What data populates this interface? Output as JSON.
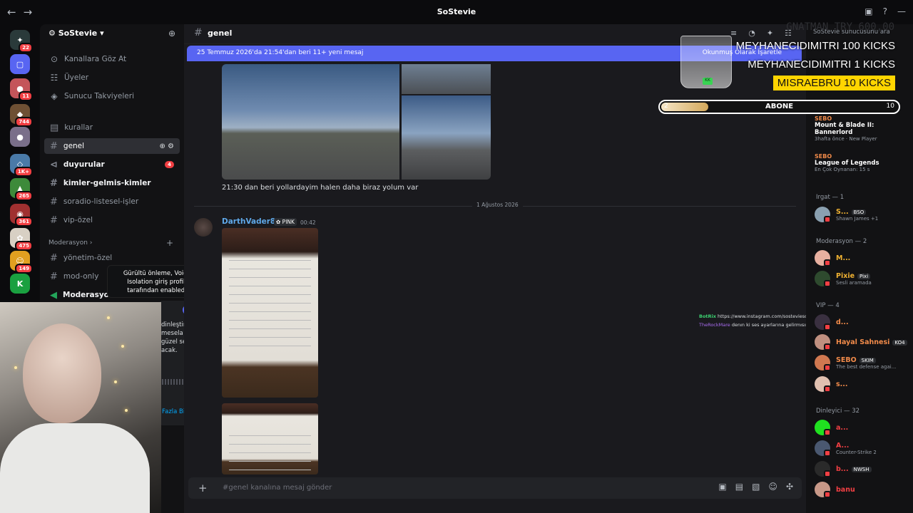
{
  "window": {
    "title": "SoStevie"
  },
  "rail": {
    "badges": [
      "22",
      "11",
      "744",
      "1K+",
      "265",
      "361",
      "475",
      "149"
    ]
  },
  "sidebar": {
    "server_name": "SoStevie",
    "top_items": [
      {
        "label": "Kanallara Göz At",
        "icon": "compass-icon"
      },
      {
        "label": "Üyeler",
        "icon": "members-icon"
      },
      {
        "label": "Sunucu Takviyeleri",
        "icon": "boost-icon"
      }
    ],
    "channels": [
      {
        "name": "kurallar",
        "icon": "rules-icon"
      },
      {
        "name": "genel",
        "active": true
      },
      {
        "name": "duyurular",
        "mention": "4"
      },
      {
        "name": "kimler-gelmis-kimler"
      },
      {
        "name": "soradio-listesel-işler"
      },
      {
        "name": "vip-özel"
      }
    ],
    "category": "Moderasyon",
    "mod_channels": [
      {
        "name": "yönetim-özel"
      },
      {
        "name": "mod-only"
      },
      {
        "name": "Moderasyon"
      }
    ]
  },
  "tooltip": {
    "text": "Gürültü önleme, Voice Isolation giriş profili tarafından enabled."
  },
  "popover": {
    "lines": [
      "dinleştir!",
      "mesela ellerini",
      "güzel sesin",
      "acak."
    ],
    "link": "Fazla Bilgi Edin"
  },
  "main": {
    "channel": "genel",
    "new_messages": "25 Temmuz 2026'da 21:54'dan beri 11+ yeni mesaj",
    "mark_read": "Okunmuş Olarak İşaretle",
    "message_text": "21:30 dan beri yollardayim halen daha biraz yolum var",
    "date_divider": "1 Ağustos 2026",
    "message2": {
      "author": "DarthVader88",
      "role": "PINK",
      "time": "00:42"
    },
    "composer_placeholder": "#genel kanalına mesaj gönder"
  },
  "chat_overlay": [
    {
      "user": "BotRix",
      "text": "https://www.instagram.com/sostevieso/"
    },
    {
      "user": "TheRockMare",
      "text": "denın ki ses ayarlarına gelirmısın"
    }
  ],
  "overlay": {
    "amount": "GNATMAN TRY 600,00",
    "lines": [
      "MEYHANECIDIMITRI  100 KICKS",
      "MEYHANECIDIMITRI  1 KICKS"
    ],
    "highlight": "MISRAEBRU  10 KICKS",
    "sub_goal": {
      "label": "ABONE",
      "current": "2",
      "target": "10",
      "progress": 0.2
    }
  },
  "members": {
    "search_placeholder": "SoStevie sunucusunu ara",
    "activities": [
      {
        "by": "SEBO",
        "title": "Mount & Blade II: Bannerlord",
        "sub": "3hafta önce · New Player"
      },
      {
        "by": "SEBO",
        "title": "League of Legends",
        "sub": "En Çok Oynanan: 15 s"
      }
    ],
    "groups": [
      {
        "label": "Irgat — 1",
        "items": [
          {
            "name": "S...",
            "tag": "BSO",
            "status": "Shawn James +1",
            "color": "#f0b232"
          }
        ]
      },
      {
        "label": "Moderasyon — 2",
        "items": [
          {
            "name": "M...",
            "color": "#f0b232"
          },
          {
            "name": "Pixie",
            "tag": "Pixi",
            "status": "Sesli aramada",
            "color": "#f0b232"
          }
        ]
      },
      {
        "label": "VIP — 4",
        "items": [
          {
            "name": "d...",
            "color": "#f28b4a"
          },
          {
            "name": "Hayal Sahnesi",
            "tag": "KO4",
            "color": "#f28b4a"
          },
          {
            "name": "SEBO",
            "tag": "SKIM",
            "status": "The best defense agai...",
            "color": "#f28b4a"
          },
          {
            "name": "s...",
            "color": "#f28b4a"
          }
        ]
      },
      {
        "label": "Dinleyici — 32",
        "items": [
          {
            "name": "a...",
            "color": "#f23f43"
          },
          {
            "name": "A...",
            "status": "Counter-Strike 2",
            "color": "#f23f43"
          },
          {
            "name": "b...",
            "tag": "NWSH",
            "color": "#f23f43"
          },
          {
            "name": "banu",
            "color": "#f23f43"
          }
        ]
      }
    ]
  }
}
